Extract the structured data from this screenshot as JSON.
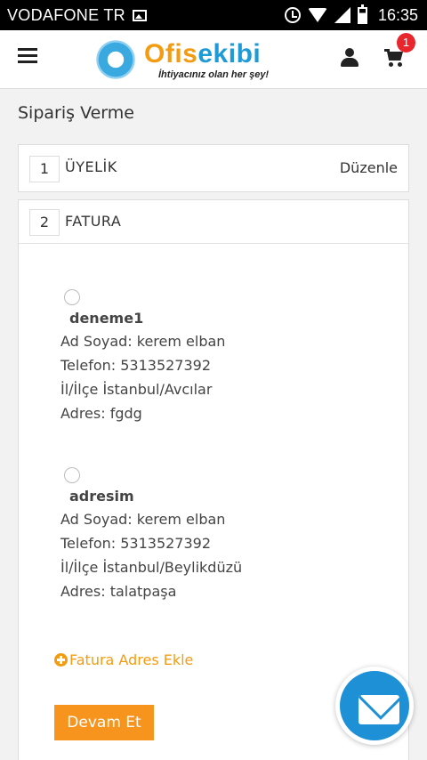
{
  "status_bar": {
    "carrier": "VODAFONE TR",
    "time": "16:35"
  },
  "header": {
    "logo": {
      "text_part1": "Ofis",
      "text_part2": "ekibi",
      "tagline": "İhtiyacınız olan her şey!"
    },
    "cart_count": "1"
  },
  "page": {
    "title": "Sipariş Verme"
  },
  "steps": [
    {
      "number": "1",
      "label": "ÜYELİK",
      "edit_label": "Düzenle"
    },
    {
      "number": "2",
      "label": "FATURA"
    }
  ],
  "addresses": [
    {
      "name": "deneme1",
      "full_name": "Ad Soyad: kerem elban",
      "phone": "Telefon: 5313527392",
      "city": "İl/İlçe İstanbul/Avcılar",
      "address": "Adres: fgdg"
    },
    {
      "name": "adresim",
      "full_name": "Ad Soyad: kerem elban",
      "phone": "Telefon: 5313527392",
      "city": "İl/İlçe İstanbul/Beylikdüzü",
      "address": "Adres: talatpaşa"
    }
  ],
  "actions": {
    "add_address": "Fatura Adres Ekle",
    "continue": "Devam Et"
  },
  "colors": {
    "accent": "#f7941d",
    "brand_blue": "#1e90d6",
    "badge": "#e8262d"
  }
}
